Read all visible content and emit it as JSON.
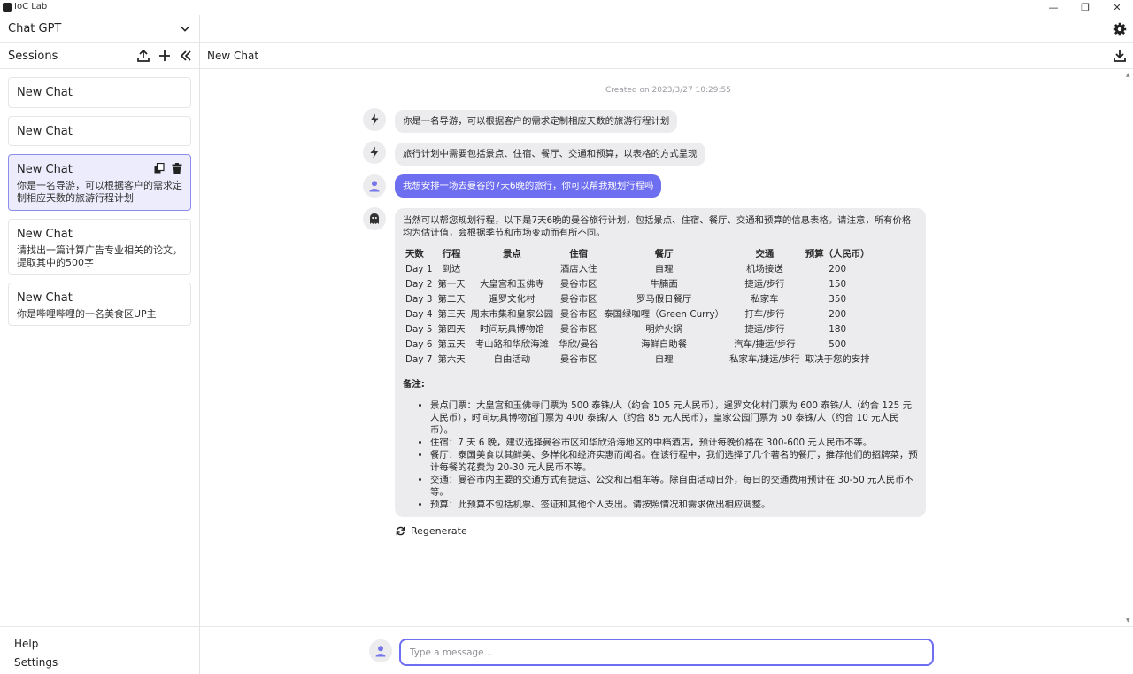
{
  "window": {
    "app_title": "IoC Lab",
    "minimize": "—",
    "maximize": "❐",
    "close": "✕"
  },
  "sidebar": {
    "model": "Chat GPT",
    "sessions_label": "Sessions",
    "sessions": [
      {
        "title": "New Chat",
        "desc": ""
      },
      {
        "title": "New Chat",
        "desc": ""
      },
      {
        "title": "New Chat",
        "desc": "你是一名导游，可以根据客户的需求定制相应天数的旅游行程计划"
      },
      {
        "title": "New Chat",
        "desc": "请找出一篇计算广告专业相关的论文，提取其中的500字"
      },
      {
        "title": "New Chat",
        "desc": "你是哔哩哔哩的一名美食区UP主"
      }
    ],
    "help": "Help",
    "settings": "Settings"
  },
  "chat": {
    "title": "New Chat",
    "created": "Created on 2023/3/27 10:29:55",
    "messages": [
      {
        "role": "system",
        "text": "你是一名导游，可以根据客户的需求定制相应天数的旅游行程计划"
      },
      {
        "role": "system",
        "text": "旅行计划中需要包括景点、住宿、餐厅、交通和预算，以表格的方式呈现"
      },
      {
        "role": "user",
        "text": "我想安排一场去曼谷的7天6晚的旅行，你可以帮我规划行程吗"
      }
    ],
    "reply": {
      "intro": "当然可以帮您规划行程，以下是7天6晚的曼谷旅行计划，包括景点、住宿、餐厅、交通和预算的信息表格。请注意，所有价格均为估计值，会根据季节和市场变动而有所不同。",
      "table": {
        "headers": [
          "天数",
          "行程",
          "景点",
          "住宿",
          "餐厅",
          "交通",
          "预算（人民币）"
        ],
        "rows": [
          [
            "Day 1",
            "到达",
            "",
            "酒店入住",
            "自理",
            "机场接送",
            "200"
          ],
          [
            "Day 2",
            "第一天",
            "大皇宫和玉佛寺",
            "曼谷市区",
            "牛腩面",
            "捷运/步行",
            "150"
          ],
          [
            "Day 3",
            "第二天",
            "暹罗文化村",
            "曼谷市区",
            "罗马假日餐厅",
            "私家车",
            "350"
          ],
          [
            "Day 4",
            "第三天",
            "周末市集和皇家公园",
            "曼谷市区",
            "泰国绿咖喱（Green Curry）",
            "打车/步行",
            "200"
          ],
          [
            "Day 5",
            "第四天",
            "时间玩具博物馆",
            "曼谷市区",
            "明炉火锅",
            "捷运/步行",
            "180"
          ],
          [
            "Day 6",
            "第五天",
            "考山路和华欣海滩",
            "华欣/曼谷",
            "海鲜自助餐",
            "汽车/捷运/步行",
            "500"
          ],
          [
            "Day 7",
            "第六天",
            "自由活动",
            "曼谷市区",
            "自理",
            "私家车/捷运/步行",
            "取决于您的安排"
          ]
        ]
      },
      "notes_title": "备注:",
      "notes": [
        "景点门票：大皇宫和玉佛寺门票为 500 泰铢/人（约合 105 元人民币），暹罗文化村门票为 600 泰铢/人（约合 125 元人民币），时间玩具博物馆门票为 400 泰铢/人（约合 85 元人民币），皇家公园门票为 50 泰铢/人（约合 10 元人民币）。",
        "住宿：7 天 6 晚，建议选择曼谷市区和华欣沿海地区的中档酒店，预计每晚价格在 300-600 元人民币不等。",
        "餐厅：泰国美食以其鲜美、多样化和经济实惠而闻名。在该行程中，我们选择了几个著名的餐厅，推荐他们的招牌菜，预计每餐的花费为 20-30 元人民币不等。",
        "交通：曼谷市内主要的交通方式有捷运、公交和出租车等。除自由活动日外，每日的交通费用预计在 30-50 元人民币不等。",
        "预算：此预算不包括机票、签证和其他个人支出。请按照情况和需求做出相应调整。"
      ]
    },
    "regenerate": "Regenerate",
    "input_placeholder": "Type a message..."
  },
  "colors": {
    "accent": "#6e6ef0",
    "active_session_bg": "#ececfc",
    "bubble_bg": "#ececef"
  }
}
